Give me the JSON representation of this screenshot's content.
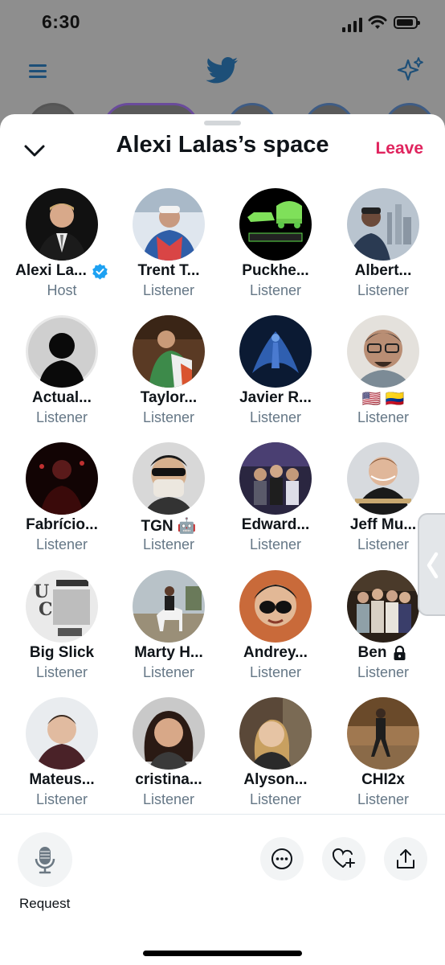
{
  "status": {
    "time": "6:30"
  },
  "background": {
    "icons": [
      "menu-icon",
      "twitter-bird-icon",
      "sparkle-icon"
    ]
  },
  "sheet": {
    "title": "Alexi Lalas’s space",
    "leave_label": "Leave",
    "collapse_icon": "chevron-down-icon"
  },
  "participants": [
    {
      "name": "Alexi La...",
      "role": "Host",
      "badge": "verified-badge-icon"
    },
    {
      "name": "Trent T...",
      "role": "Listener"
    },
    {
      "name": "Puckhe...",
      "role": "Listener"
    },
    {
      "name": "Albert...",
      "role": "Listener"
    },
    {
      "name": "Actual...",
      "role": "Listener"
    },
    {
      "name": "Taylor...",
      "role": "Listener"
    },
    {
      "name": "Javier R...",
      "role": "Listener"
    },
    {
      "name": "🇺🇸 🇨🇴",
      "role": "Listener"
    },
    {
      "name": "Fabrício...",
      "role": "Listener"
    },
    {
      "name": "TGN  🤖",
      "role": "Listener"
    },
    {
      "name": "Edward...",
      "role": "Listener"
    },
    {
      "name": "Jeff Mu...",
      "role": "Listener"
    },
    {
      "name": "Big Slick",
      "role": "Listener"
    },
    {
      "name": "Marty H...",
      "role": "Listener"
    },
    {
      "name": "Andrey...",
      "role": "Listener"
    },
    {
      "name": "Ben",
      "role": "Listener",
      "badge": "lock-icon"
    },
    {
      "name": "Mateus...",
      "role": "Listener"
    },
    {
      "name": "cristina...",
      "role": "Listener"
    },
    {
      "name": "Alyson...",
      "role": "Listener"
    },
    {
      "name": "CHI2x",
      "role": "Listener"
    }
  ],
  "bottom": {
    "request_label": "Request",
    "buttons": [
      "more-icon",
      "heart-plus-icon",
      "share-icon"
    ]
  },
  "colors": {
    "accent": "#1da1f2",
    "leave": "#e0245e",
    "secondary_text": "#657786"
  }
}
